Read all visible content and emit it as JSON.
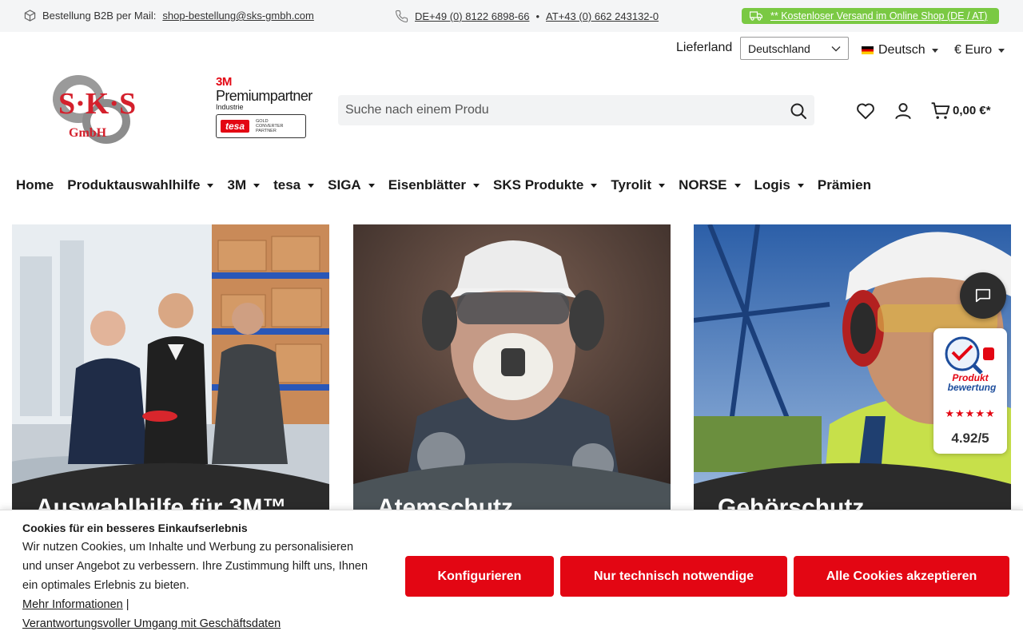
{
  "topbar": {
    "order_label": "Bestellung B2B per Mail:",
    "order_email": "shop-bestellung@sks-gmbh.com",
    "phone_de": "DE+49 (0) 8122 6898-66",
    "separator": "•",
    "phone_at": "AT+43 (0) 662 243132-0",
    "shipping": "** Kostenloser Versand im Online Shop (DE / AT)"
  },
  "locale": {
    "country_label": "Lieferland",
    "country_value": "Deutschland",
    "language": "Deutsch",
    "currency": "€ Euro"
  },
  "brand": {
    "logo_text": "S·K·S",
    "logo_sub": "GmbH",
    "partner_3m": "3M",
    "partner_line1": "Premiumpartner",
    "partner_line2": "Industrie",
    "tesa": "tesa",
    "tesa_badge": [
      "GOLD",
      "CONVERTER",
      "PARTNER"
    ]
  },
  "search": {
    "placeholder": "Suche nach einem Produ"
  },
  "cart": {
    "total": "0,00 €*"
  },
  "nav": [
    {
      "label": "Home",
      "dropdown": false
    },
    {
      "label": "Produktauswahlhilfe",
      "dropdown": true
    },
    {
      "label": "3M",
      "dropdown": true
    },
    {
      "label": "tesa",
      "dropdown": true
    },
    {
      "label": "SIGA",
      "dropdown": true
    },
    {
      "label": "Eisenblätter",
      "dropdown": true
    },
    {
      "label": "SKS Produkte",
      "dropdown": true
    },
    {
      "label": "Tyrolit",
      "dropdown": true
    },
    {
      "label": "NORSE",
      "dropdown": true
    },
    {
      "label": "Logis",
      "dropdown": true
    },
    {
      "label": "Prämien",
      "dropdown": false
    }
  ],
  "tiles": [
    {
      "title": "Auswahlhilfe für 3M™"
    },
    {
      "title": "Atemschutz"
    },
    {
      "title": "Gehörschutz"
    }
  ],
  "rating": {
    "badge_line1": "Produkt",
    "badge_line2": "bewertung",
    "stars": "★★★★★",
    "score": "4.92/5"
  },
  "cookie": {
    "title": "Cookies für ein besseres Einkaufserlebnis",
    "text": "Wir nutzen Cookies, um Inhalte und Werbung zu personalisieren und unser Angebot zu verbessern. Ihre Zustimmung hilft uns, Ihnen ein optimales Erlebnis zu bieten.",
    "more_info": "Mehr Informationen",
    "link_sep": "|",
    "responsible": "Verantwortungsvoller Umgang mit Geschäftsdaten",
    "btn_configure": "Konfigurieren",
    "btn_necessary": "Nur technisch notwendige",
    "btn_accept_all": "Alle Cookies akzeptieren"
  },
  "colors": {
    "brand_red": "#e30613",
    "ship_green": "#7ac943",
    "dark_band": "#2b2b2b",
    "gray_band": "#4b5358"
  }
}
